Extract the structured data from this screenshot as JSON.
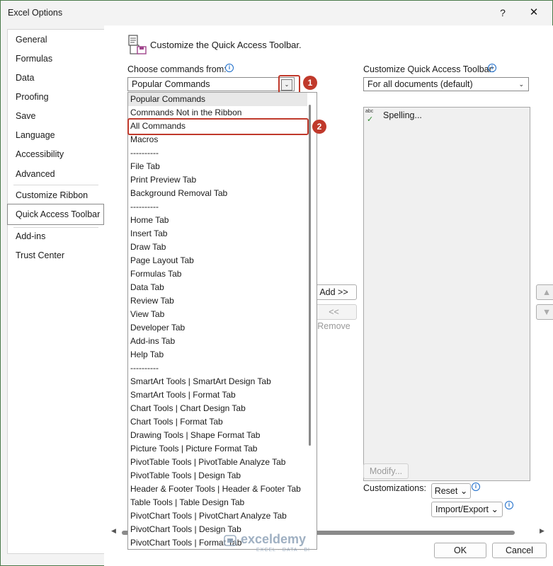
{
  "window": {
    "title": "Excel Options",
    "help_label": "?",
    "close_label": "✕"
  },
  "sidebar": {
    "items": [
      {
        "label": "General"
      },
      {
        "label": "Formulas"
      },
      {
        "label": "Data"
      },
      {
        "label": "Proofing"
      },
      {
        "label": "Save"
      },
      {
        "label": "Language"
      },
      {
        "label": "Accessibility"
      },
      {
        "label": "Advanced"
      },
      {
        "label": "Customize Ribbon"
      },
      {
        "label": "Quick Access Toolbar"
      },
      {
        "label": "Add-ins"
      },
      {
        "label": "Trust Center"
      }
    ],
    "selected": "Quick Access Toolbar"
  },
  "header": {
    "text": "Customize the Quick Access Toolbar.",
    "icon": "toolbar-icon"
  },
  "choose": {
    "label": "Choose commands from:",
    "value": "Popular Commands",
    "options": [
      "Popular Commands",
      "Commands Not in the Ribbon",
      "All Commands",
      "Macros",
      "----------",
      "File Tab",
      "Print Preview Tab",
      "Background Removal Tab",
      "----------",
      "Home Tab",
      "Insert Tab",
      "Draw Tab",
      "Page Layout Tab",
      "Formulas Tab",
      "Data Tab",
      "Review Tab",
      "View Tab",
      "Developer Tab",
      "Add-ins Tab",
      "Help Tab",
      "----------",
      "SmartArt Tools | SmartArt Design Tab",
      "SmartArt Tools | Format Tab",
      "Chart Tools | Chart Design Tab",
      "Chart Tools | Format Tab",
      "Drawing Tools | Shape Format Tab",
      "Picture Tools | Picture Format Tab",
      "PivotTable Tools | PivotTable Analyze Tab",
      "PivotTable Tools | Design Tab",
      "Header & Footer Tools | Header & Footer Tab",
      "Table Tools | Table Design Tab",
      "PivotChart Tools | PivotChart Analyze Tab",
      "PivotChart Tools | Design Tab",
      "PivotChart Tools | Format Tab"
    ]
  },
  "customize": {
    "label": "Customize Quick Access Toolbar:",
    "value": "For all documents (default)",
    "items": [
      {
        "label": "Spelling...",
        "icon_text": "abc"
      }
    ]
  },
  "buttons": {
    "add": "Add >>",
    "remove": "<< Remove",
    "modify": "Modify...",
    "customizations_label": "Customizations:",
    "reset": "Reset",
    "import_export": "Import/Export",
    "ok": "OK",
    "cancel": "Cancel"
  },
  "annotations": {
    "step1": "1",
    "step2": "2"
  },
  "watermark": {
    "name": "exceldemy",
    "tagline": "EXCEL · DATA · BI"
  },
  "colors": {
    "annotation_red": "#c0392b",
    "info_blue": "#1a6bc9"
  }
}
